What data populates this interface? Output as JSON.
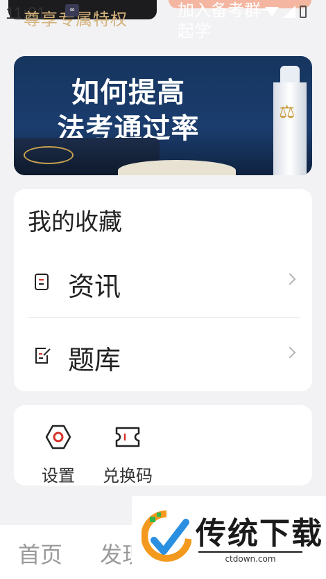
{
  "status_bar": {
    "time": "11:01"
  },
  "top_banners": {
    "vip_text": "尊享专属特权",
    "study_text": "加入备考群一起学"
  },
  "hero": {
    "title_line1": "如何提高",
    "title_line2": "法考通过率"
  },
  "favorites": {
    "title": "我的收藏",
    "items": [
      {
        "label": "资讯",
        "icon": "document-icon"
      },
      {
        "label": "题库",
        "icon": "edit-note-icon"
      }
    ]
  },
  "tools": [
    {
      "label": "设置",
      "icon": "settings-hex-icon"
    },
    {
      "label": "兑换码",
      "icon": "ticket-icon"
    }
  ],
  "bottom_nav": {
    "items": [
      {
        "label": "首页"
      },
      {
        "label": "发现"
      }
    ]
  },
  "watermark": {
    "title": "传统下载",
    "subtitle": "ctdown.com"
  },
  "colors": {
    "background": "#f2f2f4",
    "card": "#ffffff",
    "accent_red": "#d6332b",
    "vip_gold": "#d4b27a",
    "hero_blue": "#1b3d6e"
  }
}
